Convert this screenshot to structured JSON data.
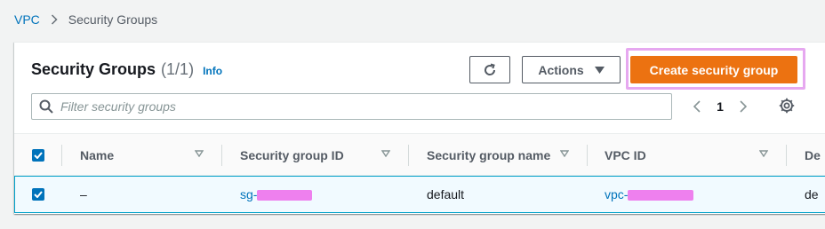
{
  "breadcrumb": {
    "root": "VPC",
    "current": "Security Groups"
  },
  "header": {
    "title": "Security Groups",
    "count": "(1/1)",
    "info": "Info"
  },
  "toolbar": {
    "actions_label": "Actions",
    "create_label": "Create security group"
  },
  "filter": {
    "placeholder": "Filter security groups"
  },
  "pagination": {
    "current_page": "1"
  },
  "table": {
    "columns": [
      "Name",
      "Security group ID",
      "Security group name",
      "VPC ID",
      "De"
    ],
    "rows": [
      {
        "name": "–",
        "security_group_id": "sg-",
        "security_group_name": "default",
        "vpc_id": "vpc-",
        "description": "de"
      }
    ]
  },
  "colors": {
    "primary_button": "#ec7211",
    "link": "#0073bb",
    "selected_row_bg": "#f1faff",
    "highlight_outline": "#e6a8f0"
  }
}
